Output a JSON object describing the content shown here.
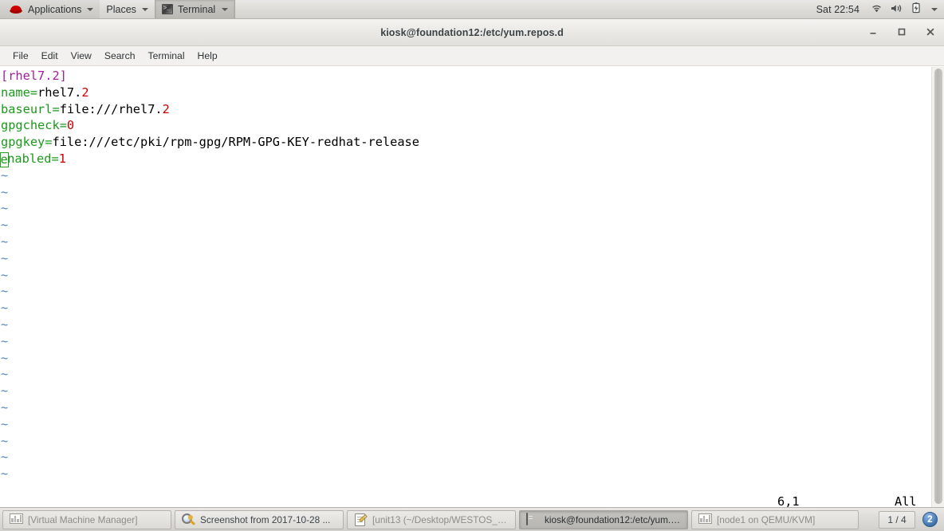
{
  "top_panel": {
    "logo": "redhat-logo",
    "applications_label": "Applications",
    "places_label": "Places",
    "active_task_label": "Terminal",
    "clock": "Sat 22:54",
    "tray_icons": [
      "wifi-icon",
      "volume-icon",
      "battery-icon",
      "chevron-down-icon"
    ]
  },
  "window": {
    "title": "kiosk@foundation12:/etc/yum.repos.d",
    "minimize_label": "–",
    "maximize_label": "□",
    "close_label": "✕",
    "menus": [
      "File",
      "Edit",
      "View",
      "Search",
      "Terminal",
      "Help"
    ]
  },
  "terminal": {
    "file_lines": [
      {
        "type": "section",
        "text": "[rhel7.2]"
      },
      {
        "type": "pair",
        "key": "name",
        "value": "rhel7.",
        "num": "2"
      },
      {
        "type": "pair",
        "key": "baseurl",
        "value": "file:///rhel7.",
        "num": "2"
      },
      {
        "type": "pair",
        "key": "gpgcheck",
        "value": "",
        "num": "0"
      },
      {
        "type": "pair",
        "key": "gpgkey",
        "value": "file:///etc/pki/rpm-gpg/RPM-GPG-KEY-redhat-release",
        "num": ""
      },
      {
        "type": "cursor",
        "key_first": "e",
        "key_rest": "nabled",
        "value": "",
        "num": "1"
      }
    ],
    "tilde": "~",
    "tilde_count": 19,
    "status_position": "6,1",
    "status_scroll": "All",
    "colors": {
      "section": "#a020a0",
      "key": "#1a9a1a",
      "value": "#000000",
      "number": "#cc0000",
      "tilde": "#5588c8",
      "cursor": "#22a022",
      "background": "#ffffff"
    }
  },
  "taskbar": {
    "tasks": [
      {
        "icon": "virtual-machine-manager-icon",
        "label": "[Virtual Machine Manager]",
        "state": "inactive"
      },
      {
        "icon": "screenshot-icon",
        "label": "Screenshot from 2017-10-28 ...",
        "state": "normal"
      },
      {
        "icon": "gedit-icon",
        "label": "[unit13 (~/Desktop/WESTOS_O...",
        "state": "inactive"
      },
      {
        "icon": "terminal-icon",
        "label": "kiosk@foundation12:/etc/yum.r...",
        "state": "active"
      },
      {
        "icon": "virtual-machine-manager-icon",
        "label": "[node1 on QEMU/KVM]",
        "state": "inactive"
      }
    ],
    "workspace_indicator": "1 / 4",
    "notification_count": "2"
  }
}
